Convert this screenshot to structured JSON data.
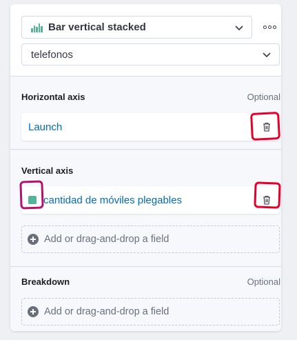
{
  "chart_type": {
    "label": "Bar vertical stacked",
    "icon": "bar-vertical-stacked-icon"
  },
  "more_actions": {
    "icon": "more-dots-icon"
  },
  "dataset": {
    "label": "telefonos"
  },
  "horizontal_axis": {
    "title": "Horizontal axis",
    "optional_label": "Optional",
    "field": {
      "label": "Launch"
    }
  },
  "vertical_axis": {
    "title": "Vertical axis",
    "field": {
      "label": "cantidad de móviles plegables",
      "color": "#54b399"
    },
    "add_field_label": "Add or drag-and-drop a field"
  },
  "breakdown": {
    "title": "Breakdown",
    "optional_label": "Optional",
    "add_field_label": "Add or drag-and-drop a field"
  },
  "colors": {
    "accent": "#006bb8",
    "series": "#54b399",
    "annotation_red": "#e4002b",
    "annotation_magenta": "#b3126d"
  }
}
